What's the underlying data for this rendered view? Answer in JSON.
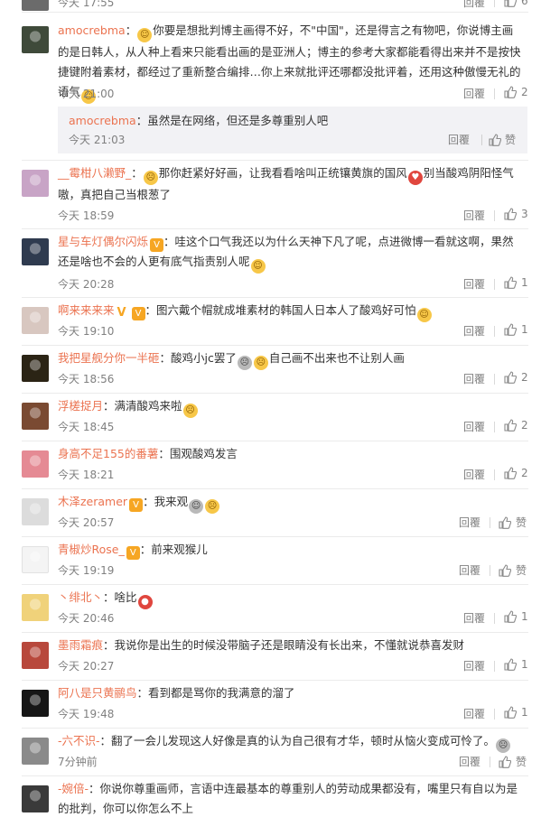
{
  "top_partial": {
    "time": "今天 17:55",
    "reply": "回覆",
    "likes": "6"
  },
  "comments": [
    {
      "username": "amocrebma",
      "text": "你要是想批判博主画得不好，不\"中国\"，还是得言之有物吧，你说博主画的是日韩人，从人种上看来只能看出画的是亚洲人；博主的参考大家都能看得出来并不是按快捷键附着素材，都经过了重新整合编排…你上来就批评还哪都没批评着，还用这种傲慢无礼的语气",
      "time": "今天 21:00",
      "reply": "回覆",
      "likes": "2",
      "sub": {
        "username": "amocrebma",
        "text": "虽然是在网络，但还是多尊重别人吧",
        "time": "今天 21:03",
        "reply": "回覆",
        "like": "赞"
      }
    },
    {
      "username": "__霉柑八濑野_",
      "text": "那你赶紧好好画，让我看看啥叫正统镶黄旗的国风",
      "text2": "别当酸鸡阴阳怪气嗷，真把自己当根葱了",
      "time": "今天 18:59",
      "reply": "回覆",
      "likes": "3"
    },
    {
      "username": "星与车灯偶尔闪烁",
      "text": "：哇这个口气我还以为什么天神下凡了呢，点进微博一看就这啊，果然还是啥也不会的人更有底气指责别人呢",
      "time": "今天 20:28",
      "reply": "回覆",
      "likes": "1"
    },
    {
      "username": "啊来来来来",
      "text": "：图六戴个帽就成堆素材的韩国人日本人了酸鸡好可怕",
      "time": "今天 19:10",
      "reply": "回覆",
      "likes": "1"
    },
    {
      "username": "我把星舰分你一半砸",
      "text": "：酸鸡小jc罢了",
      "text2": "自己画不出来也不让别人画",
      "time": "今天 18:56",
      "reply": "回覆",
      "likes": "2"
    },
    {
      "username": "浮槎捉月",
      "text": "：满清酸鸡来啦",
      "time": "今天 18:45",
      "reply": "回覆",
      "likes": "2"
    },
    {
      "username": "身高不足155的番薯",
      "text": "：围观酸鸡发言",
      "time": "今天 18:21",
      "reply": "回覆",
      "likes": "2"
    },
    {
      "username": "木泽zeramer",
      "text": "：我来观",
      "time": "今天 20:57",
      "reply": "回覆",
      "likes": "赞"
    },
    {
      "username": "青椒炒Rose_",
      "text": "：前来观猴儿",
      "time": "今天 19:19",
      "reply": "回覆",
      "likes": "赞"
    },
    {
      "username": "丶绯北丶",
      "text": "：啥比",
      "time": "今天 20:46",
      "reply": "回覆",
      "likes": "1"
    },
    {
      "username": "墨雨霜痕",
      "text": "：我说你是出生的时候没带脑子还是眼睛没有长出来，不懂就说恭喜发财",
      "time": "今天 20:27",
      "reply": "回覆",
      "likes": "1"
    },
    {
      "username": "阿八是只黄鹂鸟",
      "text": "：看到都是骂你的我满意的溜了",
      "time": "今天 19:48",
      "reply": "回覆",
      "likes": "1"
    },
    {
      "username": "-六不识-",
      "text": "：翻了一会儿发现这人好像是真的认为自己很有才华，顿时从恼火变成可怜了。",
      "time": "7分钟前",
      "reply": "回覆",
      "likes": "赞"
    },
    {
      "username": "-婉倍-",
      "text": "：你说你尊重画师，言语中连最基本的尊重别人的劳动成果都没有，嘴里只有自以为是的批判，你可以你怎么不上",
      "time": "",
      "reply": "",
      "likes": ""
    }
  ]
}
